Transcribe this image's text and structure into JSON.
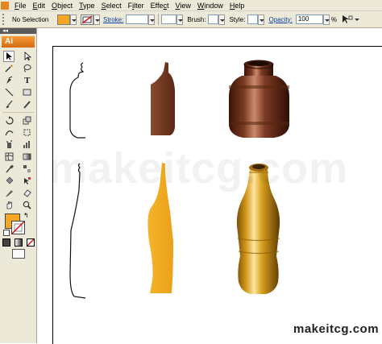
{
  "menu": [
    {
      "label": "File",
      "key": "F"
    },
    {
      "label": "Edit",
      "key": "E"
    },
    {
      "label": "Object",
      "key": "O"
    },
    {
      "label": "Type",
      "key": "T"
    },
    {
      "label": "Select",
      "key": "S"
    },
    {
      "label": "Filter",
      "key": "i"
    },
    {
      "label": "Effect",
      "key": "c"
    },
    {
      "label": "View",
      "key": "V"
    },
    {
      "label": "Window",
      "key": "W"
    },
    {
      "label": "Help",
      "key": "H"
    }
  ],
  "control_bar": {
    "selection_status": "No Selection",
    "fill_color": "#f5a623",
    "stroke_label": "Stroke:",
    "brush_label": "Brush:",
    "style_label": "Style:",
    "opacity_label": "Opacity:",
    "opacity_value": "100",
    "opacity_unit": "%"
  },
  "tools_panel": {
    "grip": "◂◂",
    "badge": "Ai",
    "fill_color": "#f5a623",
    "stroke_color": "#ffffff"
  },
  "artwork": {
    "jar_color": "#6b3220",
    "bottle_color": "#f0a21e"
  },
  "watermark": "makeitcg.com",
  "brand": "makeitcg.com"
}
